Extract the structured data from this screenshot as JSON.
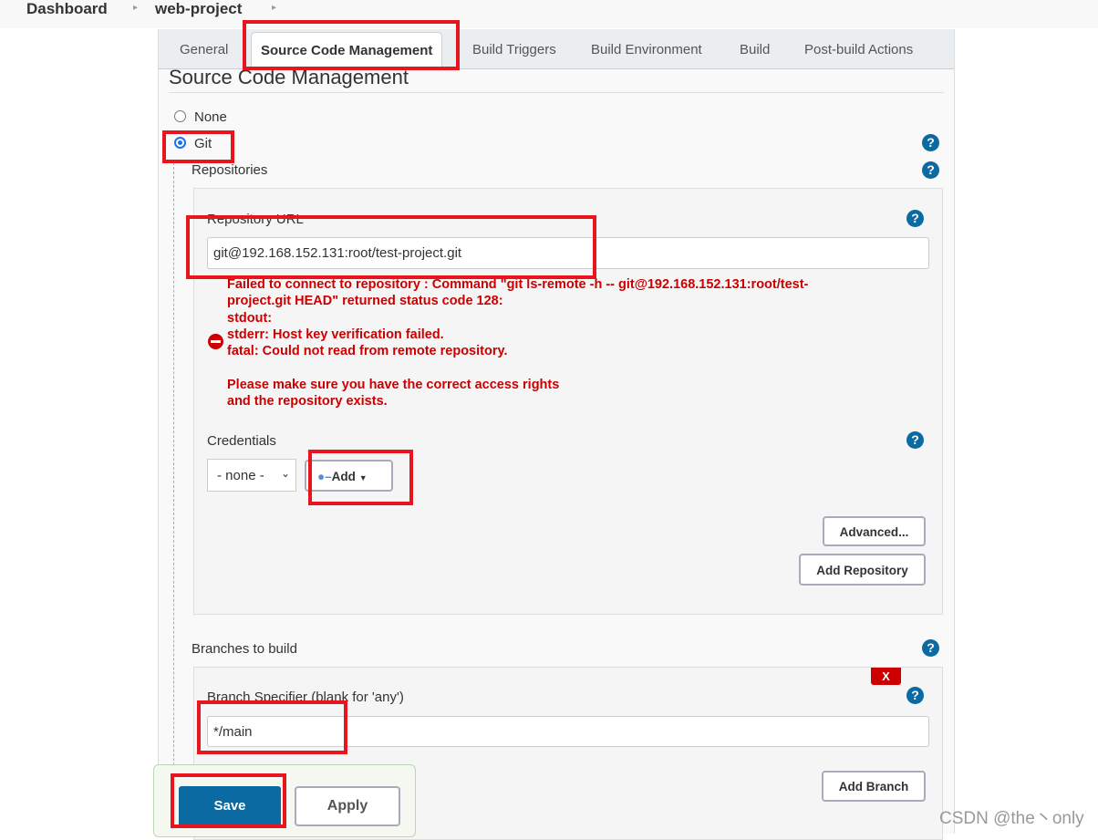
{
  "breadcrumb": {
    "items": [
      "Dashboard",
      "web-project"
    ]
  },
  "tabs": [
    {
      "label": "General"
    },
    {
      "label": "Source Code Management"
    },
    {
      "label": "Build Triggers"
    },
    {
      "label": "Build Environment"
    },
    {
      "label": "Build"
    },
    {
      "label": "Post-build Actions"
    }
  ],
  "section": {
    "title": "Source Code Management",
    "options": [
      "None",
      "Git"
    ],
    "selected": "Git"
  },
  "repositories": {
    "label": "Repositories",
    "url_label": "Repository URL",
    "url_value": "git@192.168.152.131:root/test-project.git",
    "error": "Failed to connect to repository : Command \"git ls-remote -h -- git@192.168.152.131:root/test-\nproject.git HEAD\" returned status code 128:\nstdout:\nstderr: Host key verification failed.\nfatal: Could not read from remote repository.\n\nPlease make sure you have the correct access rights\nand the repository exists.",
    "credentials_label": "Credentials",
    "credentials_value": "- none -",
    "add_label": "Add",
    "advanced_label": "Advanced...",
    "add_repository_label": "Add Repository"
  },
  "branches": {
    "label": "Branches to build",
    "delete_label": "X",
    "specifier_label": "Branch Specifier (blank for 'any')",
    "specifier_value": "*/main",
    "add_branch_label": "Add Branch"
  },
  "footer": {
    "save_label": "Save",
    "apply_label": "Apply"
  },
  "watermark": "CSDN @the丶only",
  "colors": {
    "accent": "#0b6aa2",
    "error": "#cc0000",
    "highlight": "#e8151f"
  }
}
